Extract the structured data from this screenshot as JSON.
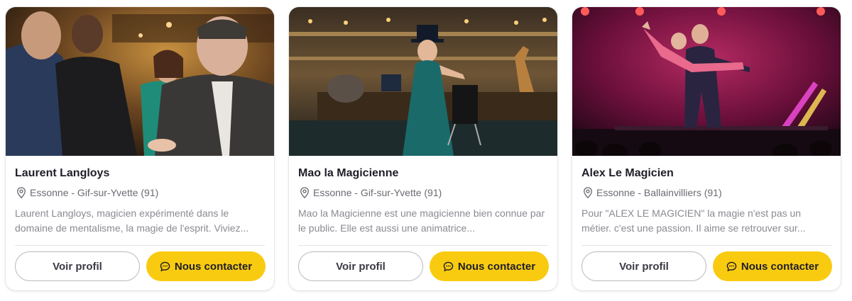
{
  "cards": [
    {
      "name": "Laurent Langloys",
      "location": "Essonne - Gif-sur-Yvette (91)",
      "description": "Laurent Langloys, magicien expérimenté dans le domaine de mentalisme, la magie de l'esprit. Viviez...",
      "profile_label": "Voir profil",
      "contact_label": "Nous contacter",
      "photo_icon": "photo-party-guests"
    },
    {
      "name": "Mao la Magicienne",
      "location": "Essonne - Gif-sur-Yvette (91)",
      "description": "Mao la Magicienne est une magicienne bien connue par le public. Elle est aussi une animatrice...",
      "profile_label": "Voir profil",
      "contact_label": "Nous contacter",
      "photo_icon": "photo-magician-museum"
    },
    {
      "name": "Alex Le Magicien",
      "location": "Essonne - Ballainvilliers (91)",
      "description": "Pour \"ALEX LE MAGICIEN\" la magie n'est pas un métier. c'est une passion. Il aime se retrouver sur...",
      "profile_label": "Voir profil",
      "contact_label": "Nous contacter",
      "photo_icon": "photo-stage-show"
    }
  ],
  "colors": {
    "accent": "#f9cb10",
    "title": "#1e1e28",
    "muted": "#8a8a92"
  }
}
